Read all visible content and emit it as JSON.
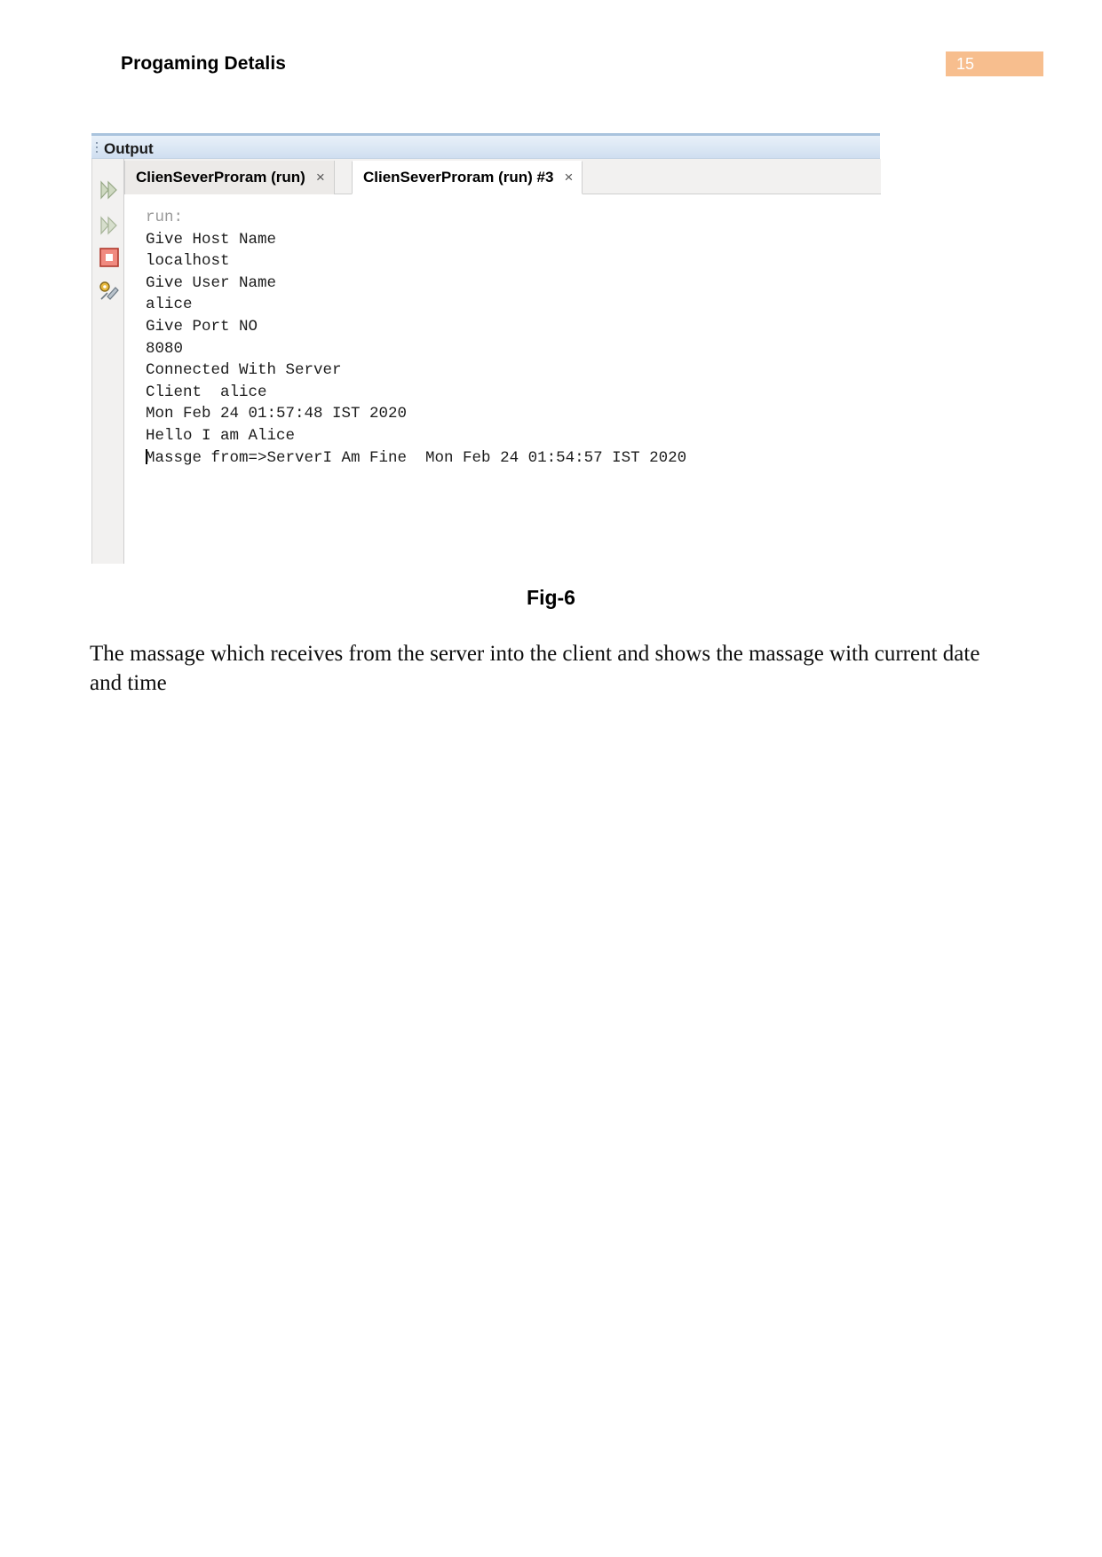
{
  "document": {
    "header_title": "Progaming Detalis",
    "page_number": "15",
    "accent_color": "#f7be8e",
    "figure_caption": "Fig-6",
    "paragraph": "The massage which receives from the server into the client and shows the massage with current date and time"
  },
  "output_window": {
    "panel_title": "Output",
    "gutter_icons": [
      {
        "name": "rerun-arrows-icon",
        "glyph": "run-arrows"
      },
      {
        "name": "rerun-arrows-secondary-icon",
        "glyph": "run-arrows"
      },
      {
        "name": "stop-process-icon",
        "glyph": "stop-square"
      },
      {
        "name": "output-settings-icon",
        "glyph": "gear-wrench"
      }
    ],
    "tabs": [
      {
        "label": "ClienSeverProram (run)",
        "close_label": "×",
        "active": false
      },
      {
        "label": "ClienSeverProram (run) #3",
        "close_label": "×",
        "active": true
      }
    ],
    "console_lines": [
      {
        "text": "run:",
        "dim": true
      },
      {
        "text": "Give Host Name",
        "dim": false
      },
      {
        "text": "localhost",
        "dim": false
      },
      {
        "text": "Give User Name",
        "dim": false
      },
      {
        "text": "alice",
        "dim": false
      },
      {
        "text": "Give Port NO",
        "dim": false
      },
      {
        "text": "8080",
        "dim": false
      },
      {
        "text": "Connected With Server",
        "dim": false
      },
      {
        "text": "Client  alice",
        "dim": false
      },
      {
        "text": "Mon Feb 24 01:57:48 IST 2020",
        "dim": false
      },
      {
        "text": "Hello I am Alice",
        "dim": false
      },
      {
        "text": "Massge from=>ServerI Am Fine  Mon Feb 24 01:54:57 IST 2020",
        "dim": false,
        "caret": true
      }
    ]
  }
}
